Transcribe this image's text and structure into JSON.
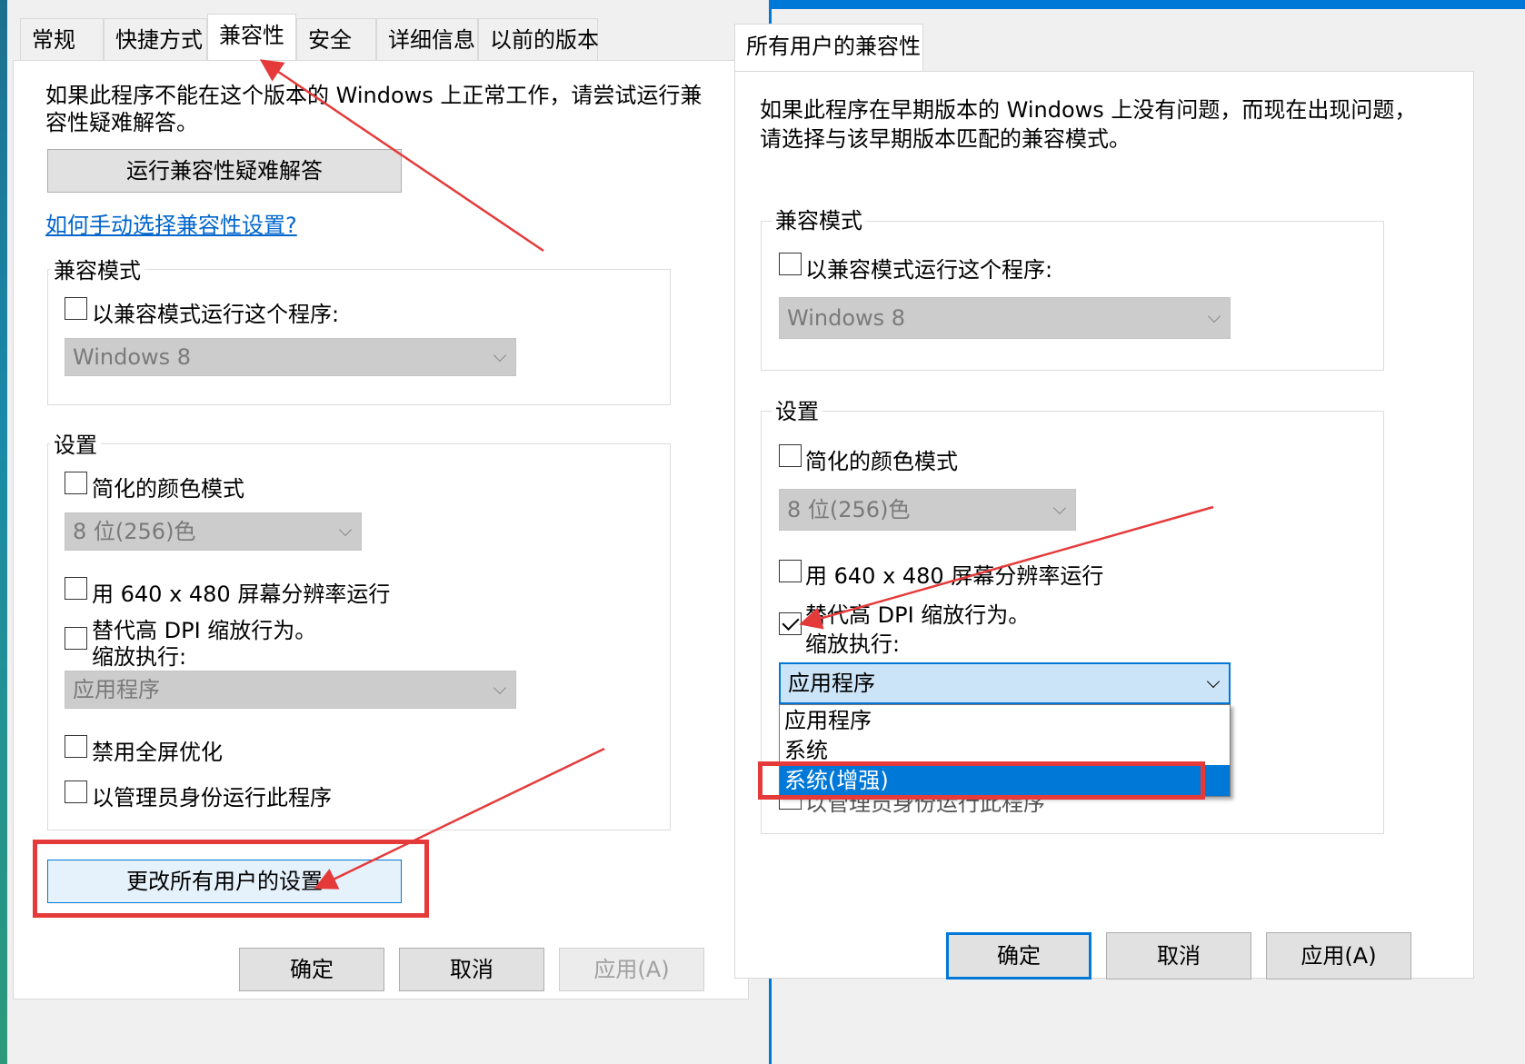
{
  "left": {
    "tabs": [
      "常规",
      "快捷方式",
      "兼容性",
      "安全",
      "详细信息",
      "以前的版本"
    ],
    "active_tab": "兼容性",
    "intro": [
      "如果此程序不能在这个版本的 Windows 上正常工作，请尝试运行兼",
      "容性疑难解答。"
    ],
    "troubleshoot_button": "运行兼容性疑难解答",
    "manual_link": "如何手动选择兼容性设置?",
    "compat_group": {
      "legend": "兼容模式",
      "run_in_compat": "以兼容模式运行这个程序:",
      "os_value": "Windows 8"
    },
    "settings_group": {
      "legend": "设置",
      "reduced_color": "简化的颜色模式",
      "color_value": "8 位(256)色",
      "res_640": "用 640 x 480 屏幕分辨率运行",
      "dpi_override_line1": "替代高 DPI 缩放行为。",
      "dpi_override_line2": "缩放执行:",
      "dpi_value": "应用程序",
      "disable_fullscreen": "禁用全屏优化",
      "run_as_admin": "以管理员身份运行此程序"
    },
    "change_all_users_button": "更改所有用户的设置",
    "ok": "确定",
    "cancel": "取消",
    "apply": "应用(A)"
  },
  "right": {
    "tab": "所有用户的兼容性",
    "intro": [
      "如果此程序在早期版本的 Windows 上没有问题，而现在出现问题，",
      "请选择与该早期版本匹配的兼容模式。"
    ],
    "compat_group": {
      "legend": "兼容模式",
      "run_in_compat": "以兼容模式运行这个程序:",
      "os_value": "Windows 8"
    },
    "settings_group": {
      "legend": "设置",
      "reduced_color": "简化的颜色模式",
      "color_value": "8 位(256)色",
      "res_640": "用 640 x 480 屏幕分辨率运行",
      "dpi_override_line1": "替代高 DPI 缩放行为。",
      "dpi_override_line2": "缩放执行:",
      "dpi_value": "应用程序",
      "dpi_checked": true,
      "dpi_options": [
        "应用程序",
        "系统",
        "系统(增强)"
      ],
      "dpi_highlighted": "系统(增强)",
      "hidden_row": "以管理员身份运行此程序"
    },
    "ok": "确定",
    "cancel": "取消",
    "apply": "应用(A)"
  },
  "annotation_color": "#e53a3a",
  "accent_color": "#0078d7"
}
